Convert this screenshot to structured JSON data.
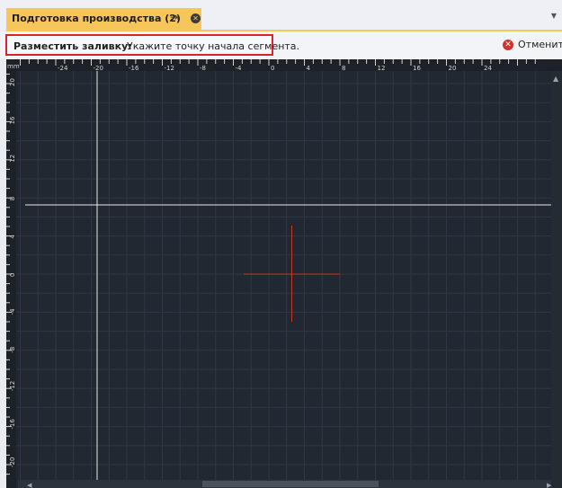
{
  "tab": {
    "title": "Подготовка производства (2)",
    "pin_icon": "pin-icon",
    "close_icon": "close-circle-icon"
  },
  "command": {
    "label": "Разместить заливку:",
    "prompt": "Укажите точку начала сегмента.",
    "cancel_label": "Отменить",
    "cancel_icon": "cancel-circle-icon"
  },
  "canvas": {
    "units": "mm",
    "h_ruler_labels": [
      "-24",
      "-20",
      "-16",
      "-12",
      "-8",
      "-4",
      "0",
      "4",
      "8",
      "12",
      "16",
      "20",
      "24"
    ],
    "v_ruler_labels": [
      "20",
      "16",
      "12",
      "8",
      "4",
      "0",
      "-4",
      "-8",
      "-12",
      "-16",
      "-20"
    ],
    "colors": {
      "background": "#222831",
      "grid": "#2f3744",
      "crosshair": "#e6e6e6",
      "origin": "#c0392b",
      "highlight": "#d7262b",
      "tab": "#f7c65a"
    }
  }
}
